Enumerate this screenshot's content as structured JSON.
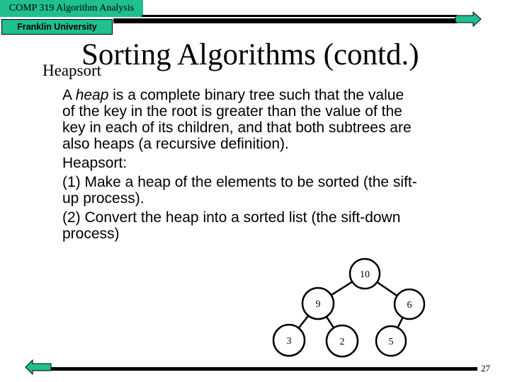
{
  "header": {
    "course": "COMP 319 Algorithm Analysis",
    "university": "Franklin University",
    "accent_color": "#1fbf8f"
  },
  "slide": {
    "title": "Sorting Algorithms (contd.)",
    "subtitle": "Heapsort",
    "body": {
      "para1": {
        "line1_prefix": "A ",
        "line1_italic": "heap",
        "line1_suffix": " is a complete binary tree such that the value",
        "line2": "of the key in the root is greater than the value of the",
        "line3": "key in each of its children, and that both subtrees are",
        "line4": "also heaps (a recursive definition)."
      },
      "para2": "Heapsort:",
      "para3": {
        "line1": "(1) Make a heap of the elements to be sorted (the sift-",
        "line2": "up process)."
      },
      "para4": {
        "line1": "(2) Convert the heap into a sorted list (the sift-down",
        "line2": "process)"
      }
    },
    "heap_tree": {
      "nodes": [
        {
          "id": "n10",
          "label": "10",
          "parent": null
        },
        {
          "id": "n9",
          "label": "9",
          "parent": "n10"
        },
        {
          "id": "n6",
          "label": "6",
          "parent": "n10"
        },
        {
          "id": "n3",
          "label": "3",
          "parent": "n9"
        },
        {
          "id": "n2",
          "label": "2",
          "parent": "n9"
        },
        {
          "id": "n5",
          "label": "5",
          "parent": "n6"
        }
      ]
    },
    "page_number": "27"
  },
  "navigation": {
    "next_icon": "right-arrow-icon",
    "prev_icon": "left-arrow-icon"
  }
}
